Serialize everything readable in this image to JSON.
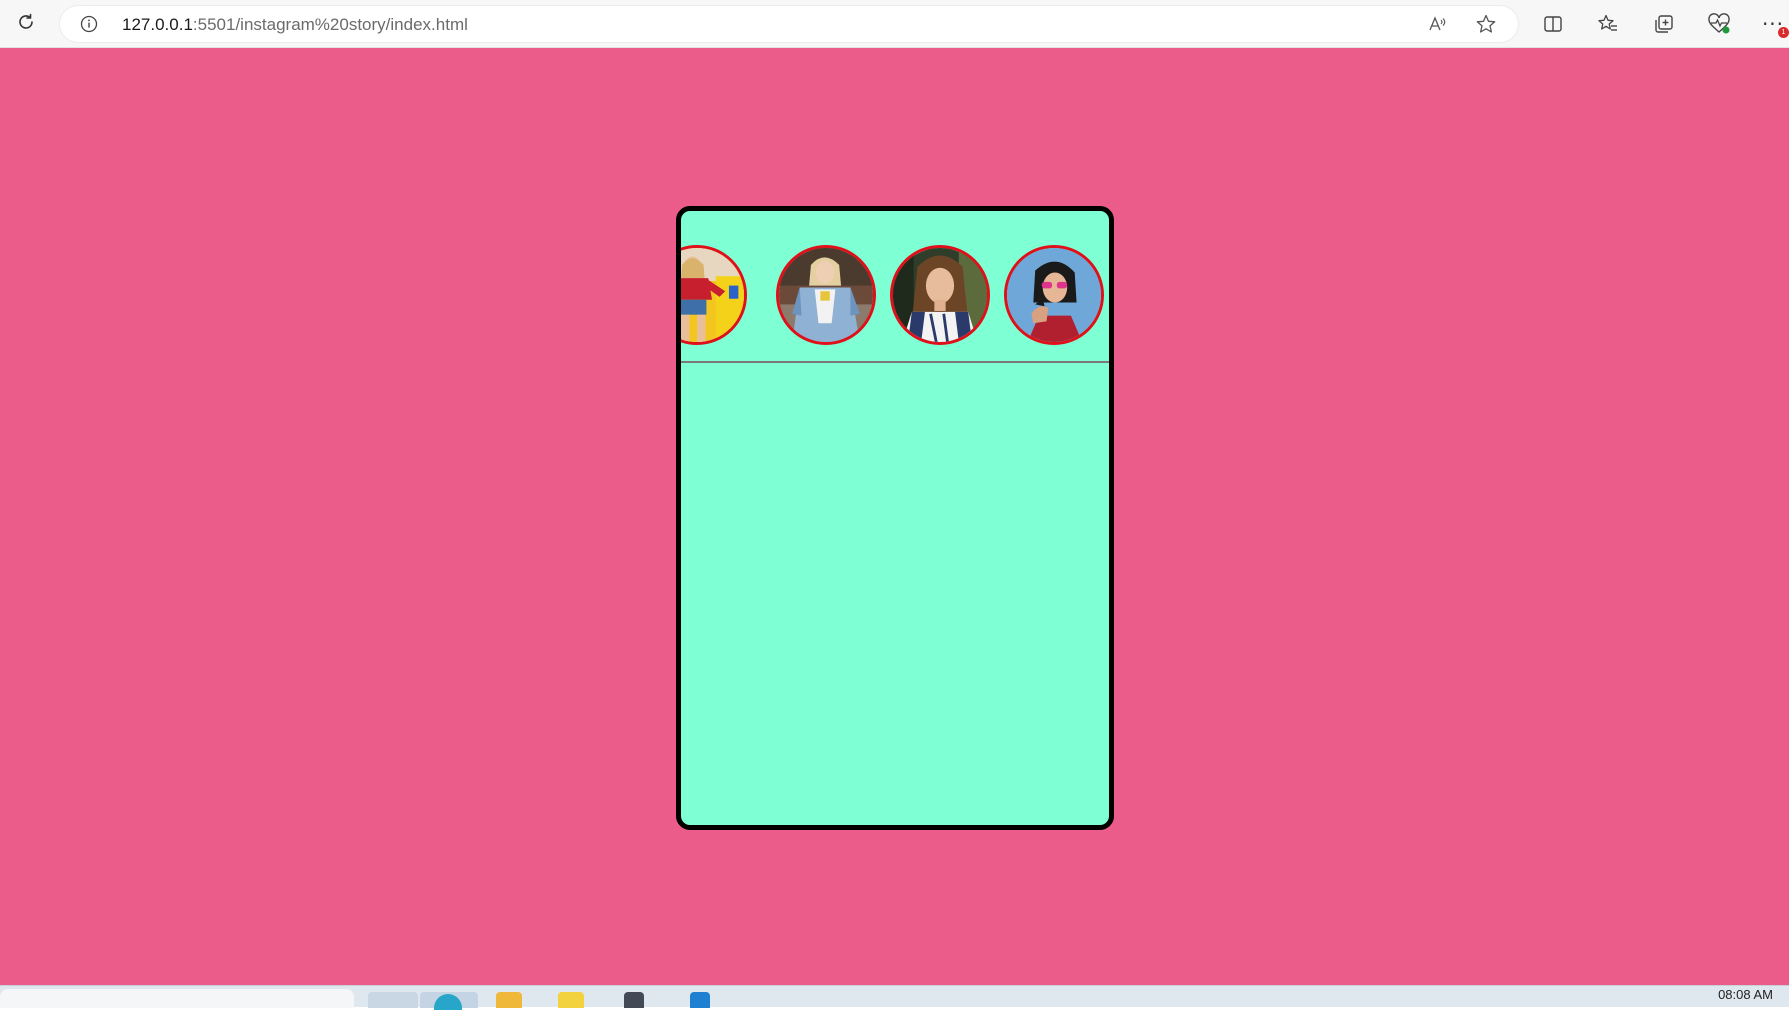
{
  "browser": {
    "url_host": "127.0.0.1",
    "url_path": ":5501/instagram%20story/index.html",
    "icons": {
      "reload": "reload-icon",
      "site_info": "info-icon",
      "read_aloud": "read-aloud-icon",
      "favorite": "star-icon",
      "split_screen": "split-screen-icon",
      "favorites": "favorites-icon",
      "collections": "collections-icon",
      "browser_essentials": "heart-pulse-icon",
      "more": "ellipsis-icon"
    },
    "more_badge": "1"
  },
  "page": {
    "background_color": "#eb5c8a",
    "card_color": "#7fffd4",
    "story_ring_color": "#e0101a",
    "stories": [
      {
        "name": "story-1",
        "photo": "woman in red top and denim shorts on yellow background"
      },
      {
        "name": "story-2",
        "photo": "woman in denim jacket laughing"
      },
      {
        "name": "story-3",
        "photo": "woman with long brown hair in striped shirt"
      },
      {
        "name": "story-4",
        "photo": "woman with pink sunglasses on blue background"
      }
    ]
  },
  "taskbar": {
    "clock": "08:08 AM"
  }
}
